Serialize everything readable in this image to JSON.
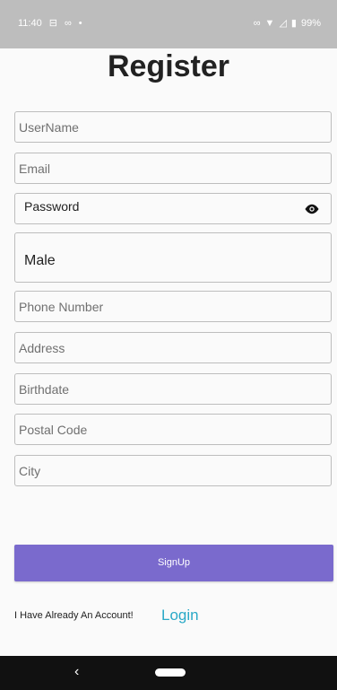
{
  "status": {
    "time": "11:40",
    "left_icons": [
      "sim-icon",
      "voicemail-icon",
      "dot-icon"
    ],
    "right_icons": [
      "link-icon",
      "wifi-icon",
      "signal-icon",
      "battery-icon"
    ],
    "battery": "99%"
  },
  "title": "Register",
  "fields": {
    "username": "UserName",
    "email": "Email",
    "password": "Password",
    "gender": "Male",
    "phone": "Phone Number",
    "address": "Address",
    "birthdate": "Birthdate",
    "postal_code": "Postal Code",
    "city": "City"
  },
  "buttons": {
    "signup": "SignUp"
  },
  "account_prompt": "I Have Already An Account!",
  "login_link": "Login",
  "nav": {
    "back": "‹"
  },
  "colors": {
    "accent": "#7a6acd",
    "link": "#2aa9c7"
  }
}
